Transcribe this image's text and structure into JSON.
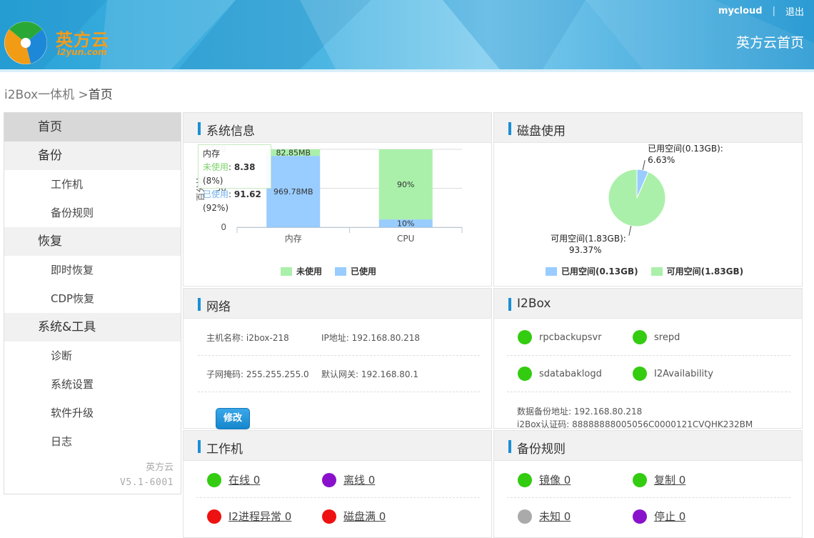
{
  "header": {
    "logo_text": "英方云",
    "logo_sub": "i2yun.com",
    "user": "mycloud",
    "logout": "退出",
    "home_title": "英方云首页"
  },
  "breadcrumb": {
    "root": "i2Box一体机",
    "sep": " >",
    "current": "首页"
  },
  "sidebar": {
    "items": [
      {
        "label": "首页",
        "kind": "active"
      },
      {
        "label": "备份",
        "kind": "group"
      },
      {
        "label": "工作机",
        "kind": "sub"
      },
      {
        "label": "备份规则",
        "kind": "sub"
      },
      {
        "label": "恢复",
        "kind": "group"
      },
      {
        "label": "即时恢复",
        "kind": "sub"
      },
      {
        "label": "CDP恢复",
        "kind": "sub"
      },
      {
        "label": "系统&工具",
        "kind": "group"
      },
      {
        "label": "诊断",
        "kind": "sub"
      },
      {
        "label": "系统设置",
        "kind": "sub"
      },
      {
        "label": "软件升级",
        "kind": "sub"
      },
      {
        "label": "日志",
        "kind": "sub"
      }
    ],
    "footer_brand": "英方云",
    "footer_version": "V5.1-6001"
  },
  "panels": {
    "sys": "系统信息",
    "disk": "磁盘使用",
    "net": "网络",
    "i2box": "I2Box",
    "work": "工作机",
    "backup": "备份规则"
  },
  "chart_data": [
    {
      "type": "bar",
      "stacked": true,
      "title": "系统信息",
      "categories": [
        "内存",
        "CPU"
      ],
      "ylabel": "百分比",
      "yticks": [
        "0",
        "50",
        "100"
      ],
      "ylim": [
        0,
        100
      ],
      "series": [
        {
          "name": "已使用",
          "color": "#99ccff",
          "values": [
            91.62,
            10
          ],
          "labels": [
            "969.78MB",
            "10%"
          ]
        },
        {
          "name": "未使用",
          "color": "#aaf0aa",
          "values": [
            8.38,
            90
          ],
          "labels": [
            "82.85MB",
            "90%"
          ]
        }
      ],
      "legend": [
        "未使用",
        "已使用"
      ],
      "tooltip": {
        "title": "内存",
        "unused_label": "未使用",
        "unused_value": "8.38",
        "unused_pct": "(8%)",
        "used_label": "已使用",
        "used_value": "91.62",
        "used_pct": "(92%)"
      }
    },
    {
      "type": "pie",
      "title": "磁盘使用",
      "slices": [
        {
          "name": "已用空间(0.13GB)",
          "value": 6.63,
          "color": "#99ccff",
          "label": "已用空间(0.13GB):",
          "pct": "6.63%"
        },
        {
          "name": "可用空间(1.83GB)",
          "value": 93.37,
          "color": "#aaf0aa",
          "label": "可用空间(1.83GB):",
          "pct": "93.37%"
        }
      ]
    }
  ],
  "network": {
    "hostname": "主机名称: i2box-218",
    "ip": "IP地址: 192.168.80.218",
    "mask": "子网掩码: 255.255.255.0",
    "gateway": "默认网关: 192.168.80.1",
    "edit_button": "修改"
  },
  "i2box": {
    "services": [
      "rpcbackupsvr",
      "srepd",
      "sdatabaklogd",
      "I2Availability"
    ],
    "status_color": "#33cc11",
    "backup_addr": "数据备份地址: 192.168.80.218",
    "auth_code": "i2Box认证码: 88888888005056C0000121CVQHK232BM"
  },
  "workers": [
    {
      "label": "在线 0",
      "color": "#33cc11"
    },
    {
      "label": "离线 0",
      "color": "#8a11cc"
    },
    {
      "label": "I2进程异常 0",
      "color": "#ee1111"
    },
    {
      "label": "磁盘满 0",
      "color": "#ee1111"
    }
  ],
  "rules": [
    {
      "label": "镜像 0",
      "color": "#33cc11"
    },
    {
      "label": "复制 0",
      "color": "#33cc11"
    },
    {
      "label": "未知 0",
      "color": "#aaaaaa"
    },
    {
      "label": "停止 0",
      "color": "#8a11cc"
    }
  ]
}
